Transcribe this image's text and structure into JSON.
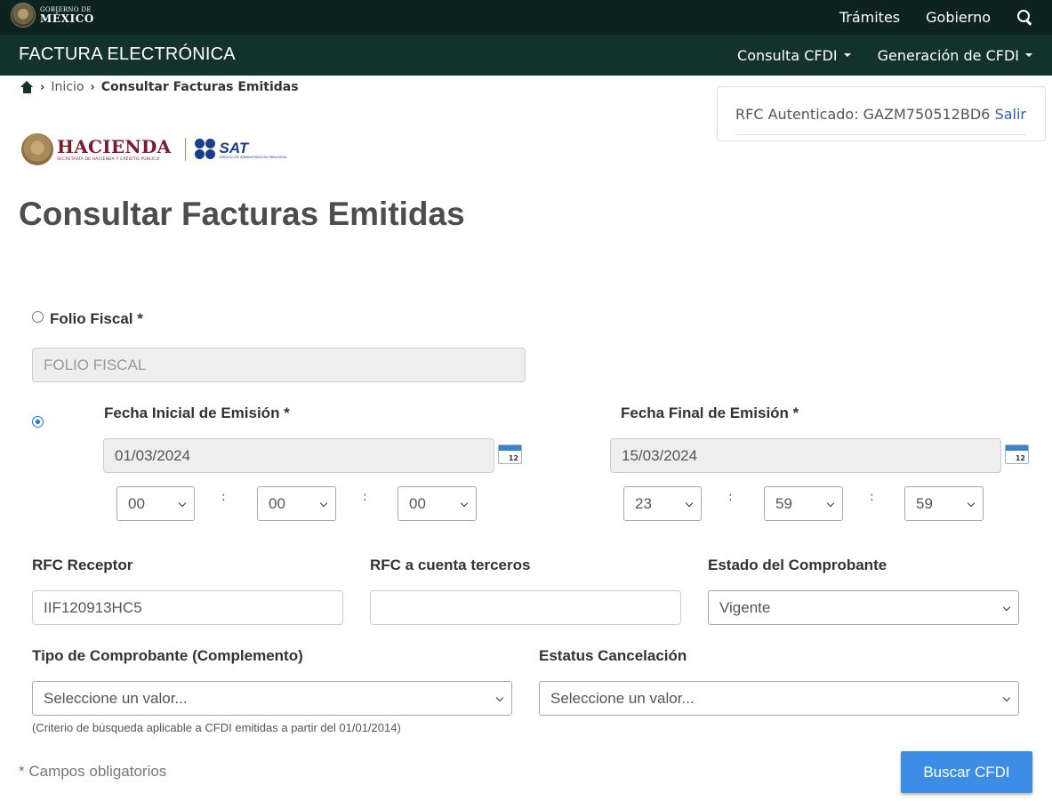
{
  "gob_bar": {
    "logo_small": "GOBIERNO DE",
    "logo_big": "MÉXICO",
    "links": [
      "Trámites",
      "Gobierno"
    ]
  },
  "app_bar": {
    "title": "FACTURA ELECTRÓNICA",
    "menu": [
      "Consulta CFDI",
      "Generación de CFDI"
    ]
  },
  "breadcrumb": {
    "home": "Inicio",
    "current": "Consultar Facturas Emitidas"
  },
  "auth": {
    "label": "RFC Autenticado: GAZM750512BD6",
    "logout": "Salir"
  },
  "logos": {
    "hacienda": "HACIENDA",
    "hacienda_sub": "SECRETARÍA DE HACIENDA Y CRÉDITO PÚBLICO",
    "sat": "SAT",
    "sat_sub": "SERVICIO DE ADMINISTRACIÓN TRIBUTARIA"
  },
  "page_title": "Consultar Facturas Emitidas",
  "folio": {
    "label": "Folio Fiscal *",
    "placeholder": "FOLIO FISCAL",
    "selected": false
  },
  "fechas": {
    "selected": true,
    "inicial": {
      "label": "Fecha Inicial de Emisión *",
      "value": "01/03/2024",
      "hour": "00",
      "minute": "00",
      "second": "00"
    },
    "final": {
      "label": "Fecha Final de Emisión *",
      "value": "15/03/2024",
      "hour": "23",
      "minute": "59",
      "second": "59"
    },
    "separator": ":",
    "calendar_day": "12"
  },
  "rfc_receptor": {
    "label": "RFC Receptor",
    "value": "IIF120913HC5"
  },
  "rfc_terceros": {
    "label": "RFC a cuenta terceros",
    "value": ""
  },
  "estado": {
    "label": "Estado del Comprobante",
    "value": "Vigente"
  },
  "tipo": {
    "label": "Tipo de Comprobante (Complemento)",
    "value": "Seleccione un valor..."
  },
  "estatus": {
    "label": "Estatus Cancelación",
    "value": "Seleccione un valor..."
  },
  "hint": "(Criterio de búsqueda aplicable a CFDI emitidas a partir del 01/01/2014)",
  "required_note": "* Campos obligatorios",
  "search_button": "Buscar CFDI",
  "colors": {
    "gob_bar": "#0c231e",
    "app_bar": "#13322b",
    "button": "#3d8de6",
    "link": "#2d5dc6",
    "hacienda": "#7b1b2e",
    "sat": "#1a3e8c"
  }
}
